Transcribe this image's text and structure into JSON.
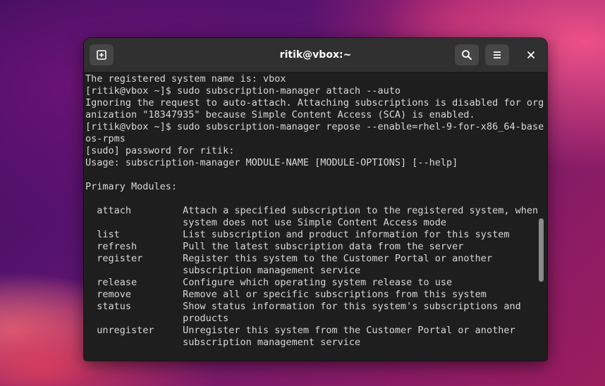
{
  "window": {
    "title": "ritik@vbox:~"
  },
  "header": {
    "icons": {
      "new_tab": "new-tab-icon",
      "search": "search-icon",
      "menu": "hamburger-menu-icon",
      "close": "close-icon"
    }
  },
  "terminal": {
    "lines": [
      "The registered system name is: vbox",
      "[ritik@vbox ~]$ sudo subscription-manager attach --auto",
      "Ignoring the request to auto-attach. Attaching subscriptions is disabled for org",
      "anization \"18347935\" because Simple Content Access (SCA) is enabled.",
      "[ritik@vbox ~]$ sudo subscription-manager repose --enable=rhel-9-for-x86_64-base",
      "os-rpms",
      "[sudo] password for ritik:",
      "Usage: subscription-manager MODULE-NAME [MODULE-OPTIONS] [--help]",
      "",
      "Primary Modules:",
      "",
      "  attach         Attach a specified subscription to the registered system, when",
      "                 system does not use Simple Content Access mode",
      "  list           List subscription and product information for this system",
      "  refresh        Pull the latest subscription data from the server",
      "  register       Register this system to the Customer Portal or another",
      "                 subscription management service",
      "  release        Configure which operating system release to use",
      "  remove         Remove all or specific subscriptions from this system",
      "  status         Show status information for this system's subscriptions and",
      "                 products",
      "  unregister     Unregister this system from the Customer Portal or another",
      "                 subscription management service"
    ]
  },
  "colors": {
    "terminal_bg": "#1e1e1e",
    "headerbar_bg": "#303030",
    "text": "#d8d8d8"
  }
}
